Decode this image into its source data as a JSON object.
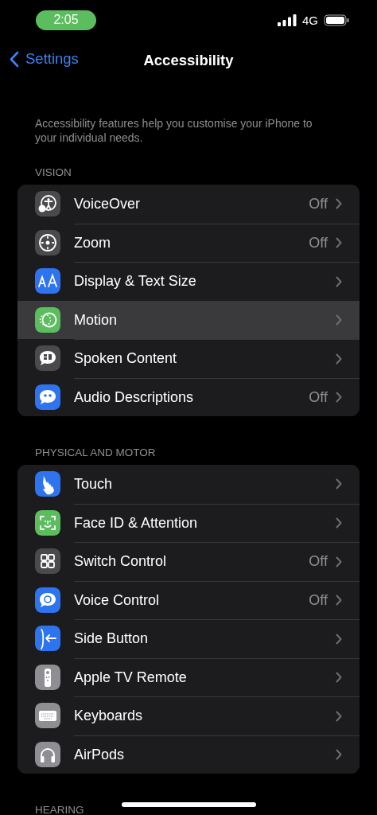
{
  "status_bar": {
    "time": "2:05",
    "network": "4G"
  },
  "nav": {
    "back": "Settings",
    "title": "Accessibility"
  },
  "description": "Accessibility features help you customise your iPhone to your individual needs.",
  "sections": [
    {
      "header": "VISION",
      "rows": [
        {
          "label": "VoiceOver",
          "value": "Off",
          "color": "#4a4a4d",
          "selected": false
        },
        {
          "label": "Zoom",
          "value": "Off",
          "color": "#4a4a4d",
          "selected": false
        },
        {
          "label": "Display & Text Size",
          "color": "#2f74ef",
          "selected": false
        },
        {
          "label": "Motion",
          "color": "#5bbd5e",
          "selected": true
        },
        {
          "label": "Spoken Content",
          "color": "#4a4a4d",
          "selected": false
        },
        {
          "label": "Audio Descriptions",
          "value": "Off",
          "color": "#2f74ef",
          "selected": false
        }
      ]
    },
    {
      "header": "PHYSICAL AND MOTOR",
      "rows": [
        {
          "label": "Touch",
          "color": "#2f74ef",
          "selected": false
        },
        {
          "label": "Face ID & Attention",
          "color": "#5bbd5e",
          "selected": false
        },
        {
          "label": "Switch Control",
          "value": "Off",
          "color": "#4a4a4d",
          "selected": false
        },
        {
          "label": "Voice Control",
          "value": "Off",
          "color": "#2f74ef",
          "selected": false
        },
        {
          "label": "Side Button",
          "color": "#2f74ef",
          "selected": false
        },
        {
          "label": "Apple TV Remote",
          "color": "#8e8e93",
          "selected": false
        },
        {
          "label": "Keyboards",
          "color": "#8e8e93",
          "selected": false
        },
        {
          "label": "AirPods",
          "color": "#8e8e93",
          "selected": false
        }
      ]
    },
    {
      "header": "HEARING"
    }
  ]
}
